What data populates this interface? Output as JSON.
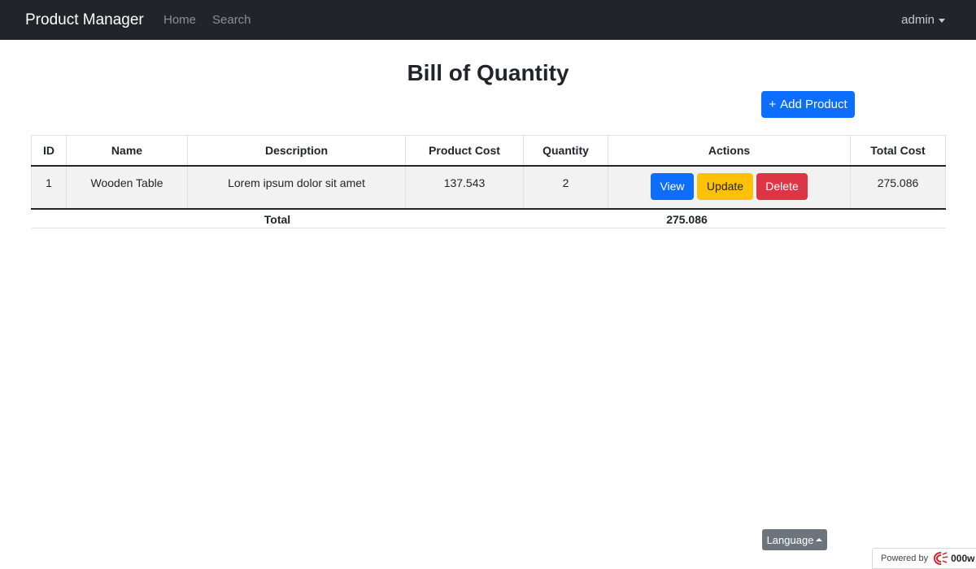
{
  "navbar": {
    "brand": "Product Manager",
    "links": [
      "Home",
      "Search"
    ],
    "user": "admin"
  },
  "page": {
    "title": "Bill of Quantity",
    "add_button_icon": "+",
    "add_button_label": "Add Product"
  },
  "table": {
    "headers": [
      "ID",
      "Name",
      "Description",
      "Product Cost",
      "Quantity",
      "Actions",
      "Total Cost"
    ],
    "rows": [
      {
        "id": "1",
        "name": "Wooden Table",
        "description": "Lorem ipsum dolor sit amet",
        "product_cost": "137.543",
        "quantity": "2",
        "actions": [
          "View",
          "Update",
          "Delete"
        ],
        "total_cost": "275.086"
      }
    ],
    "footer": {
      "label": "Total",
      "value": "275.086"
    }
  },
  "footer": {
    "language_button": "Language",
    "powered_by": "Powered by",
    "host_logo_text": "000w"
  },
  "colors": {
    "navbar": "#212529",
    "primary": "#0d6efd",
    "warning": "#ffc107",
    "danger": "#dc3545",
    "secondary": "#6c757d"
  }
}
